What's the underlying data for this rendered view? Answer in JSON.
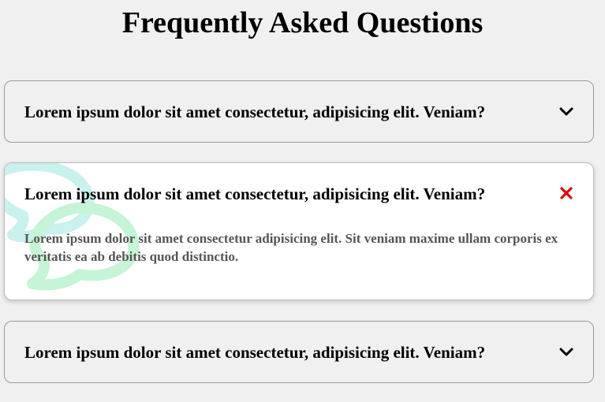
{
  "page": {
    "title": "Frequently Asked Questions"
  },
  "faqs": [
    {
      "question": "Lorem ipsum dolor sit amet consectetur, adipisicing elit. Veniam?",
      "answer": "",
      "state": "collapsed",
      "toggle_icon": "chevron-down-icon"
    },
    {
      "question": "Lorem ipsum dolor sit amet consectetur, adipisicing elit. Veniam?",
      "answer": "Lorem ipsum dolor sit amet consectetur adipisicing elit. Sit veniam maxime ullam corporis ex veritatis ea ab debitis quod distinctio.",
      "state": "expanded",
      "toggle_icon": "close-icon"
    },
    {
      "question": "Lorem ipsum dolor sit amet consectetur, adipisicing elit. Veniam?",
      "answer": "",
      "state": "collapsed",
      "toggle_icon": "chevron-down-icon"
    }
  ],
  "colors": {
    "background": "#f0f0f0",
    "active_card": "#ffffff",
    "close_icon": "#e00000",
    "deco_light": "#bff3e6",
    "deco_dark": "#c8f5d8"
  }
}
